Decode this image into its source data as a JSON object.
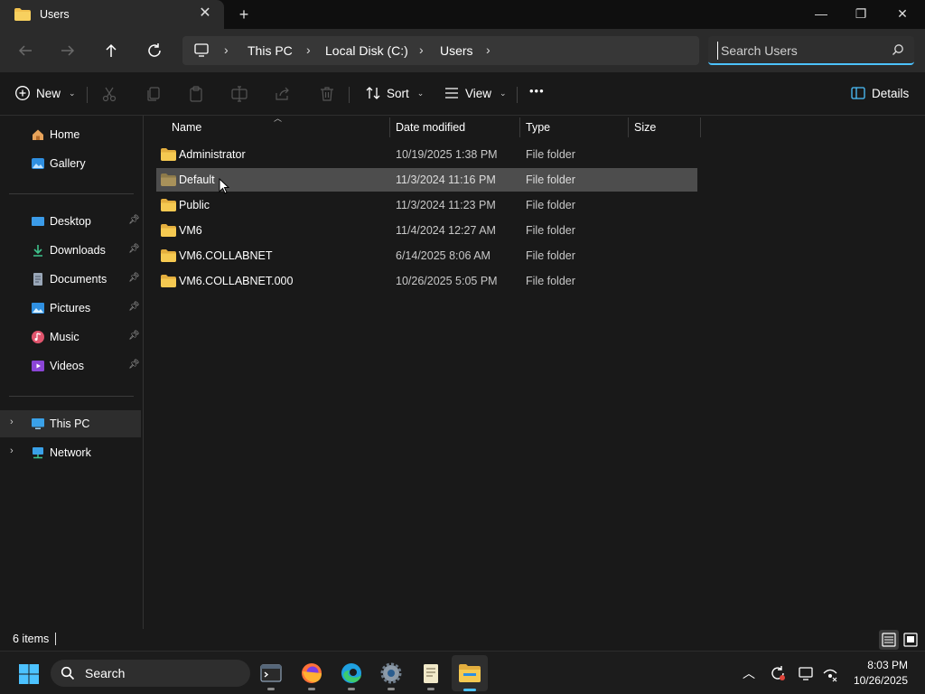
{
  "window": {
    "tab_title": "Users",
    "new_tab_label": "+",
    "minimize_label": "—",
    "maximize_label": "❐",
    "close_label": "✕"
  },
  "address_bar": {
    "breadcrumbs": [
      "This PC",
      "Local Disk (C:)",
      "Users"
    ],
    "search_placeholder": "Search Users"
  },
  "command_bar": {
    "new_label": "New",
    "sort_label": "Sort",
    "view_label": "View",
    "more_label": "•••",
    "details_label": "Details"
  },
  "sidebar": {
    "top_items": [
      {
        "label": "Home",
        "icon": "home-icon"
      },
      {
        "label": "Gallery",
        "icon": "gallery-icon"
      }
    ],
    "pinned_items": [
      {
        "label": "Desktop",
        "icon": "desktop-icon"
      },
      {
        "label": "Downloads",
        "icon": "downloads-icon"
      },
      {
        "label": "Documents",
        "icon": "documents-icon"
      },
      {
        "label": "Pictures",
        "icon": "pictures-icon"
      },
      {
        "label": "Music",
        "icon": "music-icon"
      },
      {
        "label": "Videos",
        "icon": "videos-icon"
      }
    ],
    "tree_items": [
      {
        "label": "This PC",
        "icon": "this-pc-icon",
        "selected": true
      },
      {
        "label": "Network",
        "icon": "network-icon",
        "selected": false
      }
    ]
  },
  "file_list": {
    "columns": [
      "Name",
      "Date modified",
      "Type",
      "Size"
    ],
    "rows": [
      {
        "name": "Administrator",
        "date": "10/19/2025 1:38 PM",
        "type": "File folder",
        "size": ""
      },
      {
        "name": "Default",
        "date": "11/3/2024 11:16 PM",
        "type": "File folder",
        "size": ""
      },
      {
        "name": "Public",
        "date": "11/3/2024 11:23 PM",
        "type": "File folder",
        "size": ""
      },
      {
        "name": "VM6",
        "date": "11/4/2024 12:27 AM",
        "type": "File folder",
        "size": ""
      },
      {
        "name": "VM6.COLLABNET",
        "date": "6/14/2025 8:06 AM",
        "type": "File folder",
        "size": ""
      },
      {
        "name": "VM6.COLLABNET.000",
        "date": "10/26/2025 5:05 PM",
        "type": "File folder",
        "size": ""
      }
    ]
  },
  "status_bar": {
    "item_count": "6 items"
  },
  "taskbar": {
    "search_label": "Search",
    "time": "8:03 PM",
    "date": "10/26/2025"
  },
  "colors": {
    "accent": "#4cc2ff",
    "folder": "#f2c14e",
    "background": "#191919"
  }
}
